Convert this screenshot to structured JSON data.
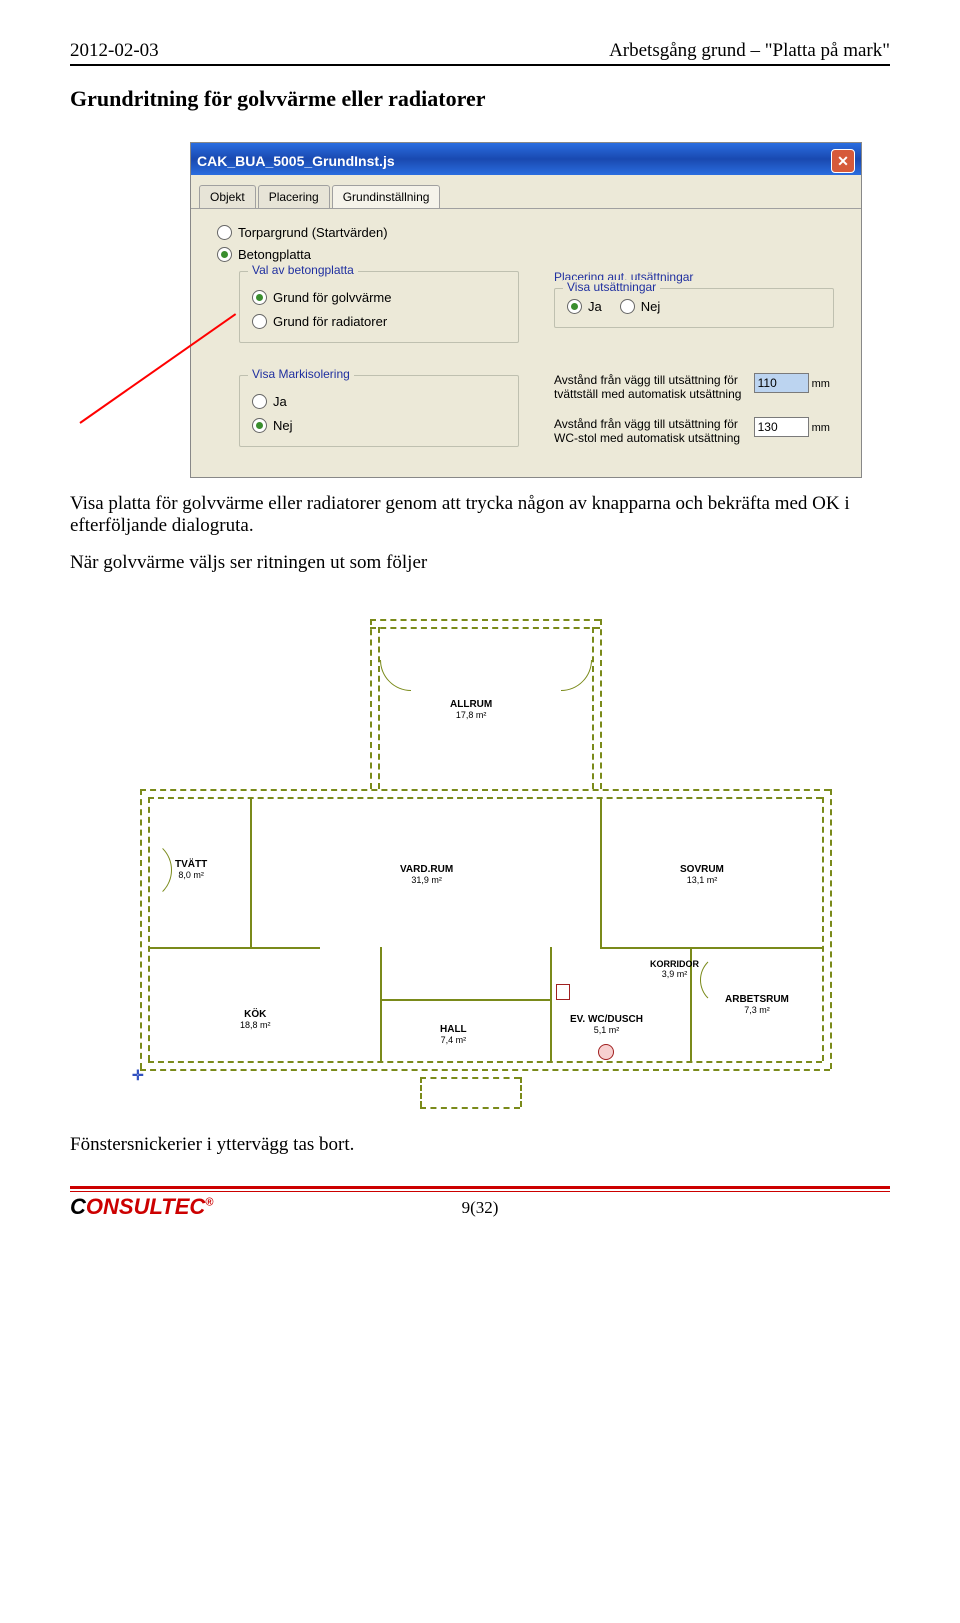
{
  "header": {
    "date": "2012-02-03",
    "doc_title": "Arbetsgång grund – \"Platta på mark\""
  },
  "section_title": "Grundritning för golvvärme eller radiatorer",
  "dialog": {
    "title": "CAK_BUA_5005_GrundInst.js",
    "tabs": [
      "Objekt",
      "Placering",
      "Grundinställning"
    ],
    "opt_torpargrund": "Torpargrund (Startvärden)",
    "opt_betong": "Betongplatta",
    "grp_val": "Val av betongplatta",
    "opt_golvvarme": "Grund för golvvärme",
    "opt_radiatorer": "Grund för radiatorer",
    "grp_placering": "Placering aut. utsättningar",
    "grp_visa_uts": "Visa utsättningar",
    "opt_ja": "Ja",
    "opt_nej": "Nej",
    "grp_markisol": "Visa Markisolering",
    "lbl_tvatt": "Avstånd från vägg till utsättning för tvättställ med automatisk utsättning",
    "val_tvatt": "110",
    "lbl_wc": "Avstånd från vägg till utsättning för WC-stol med automatisk utsättning",
    "val_wc": "130",
    "unit": "mm"
  },
  "para1": "Visa platta för golvvärme eller radiatorer genom att trycka någon av knapparna och bekräfta med OK i efterföljande dialogruta.",
  "para2": "När golvvärme väljs ser ritningen ut som följer",
  "rooms": {
    "allrum": "ALLRUM",
    "allrum_a": "17,8 m²",
    "tvatt": "TVÄTT",
    "tvatt_a": "8,0 m²",
    "vardrun": "VARD.RUM",
    "vardrun_a": "31,9 m²",
    "sovrum": "SOVRUM",
    "sovrum_a": "13,1 m²",
    "kok": "KÖK",
    "kok_a": "18,8 m²",
    "hall": "HALL",
    "hall_a": "7,4 m²",
    "wc": "EV. WC/DUSCH",
    "wc_a": "5,1 m²",
    "korridor": "KORRIDOR",
    "korridor_a": "3,9 m²",
    "arbetsrum": "ARBETSRUM",
    "arbetsrum_a": "7,3 m²"
  },
  "para3": "Fönstersnickerier i yttervägg tas bort.",
  "footer": {
    "logo_black": "C",
    "logo_red": "ONSULTEC",
    "reg": "®",
    "page": "9(32)"
  }
}
